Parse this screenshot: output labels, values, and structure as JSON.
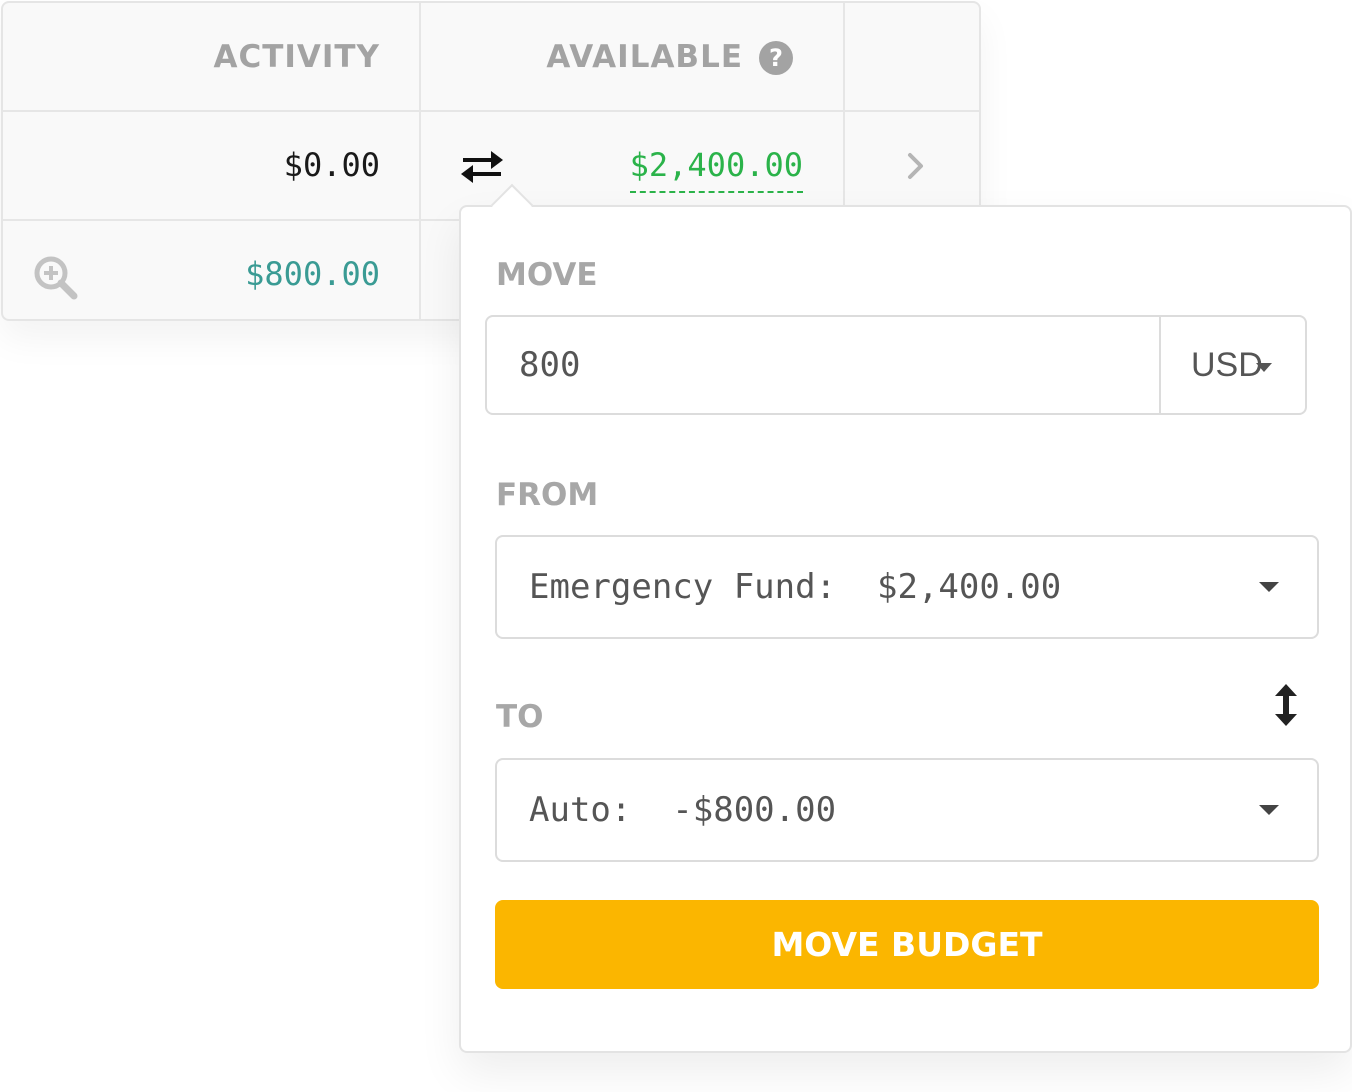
{
  "table": {
    "header": {
      "activity_label": "ACTIVITY",
      "available_label": "AVAILABLE",
      "help_icon": "question-circle-icon"
    },
    "row1": {
      "activity": "$0.00",
      "available": "$2,400.00",
      "move_icon": "swap-horizontal-icon",
      "expand_icon": "chevron-right-icon"
    },
    "row2": {
      "activity": "$800.00",
      "inspect_icon": "zoom-in-icon"
    }
  },
  "popover": {
    "move_label": "MOVE",
    "amount_value": "800",
    "currency": "USD",
    "from_label": "FROM",
    "from_value": "Emergency Fund:  $2,400.00",
    "to_label": "TO",
    "to_value": "Auto:  -$800.00",
    "swap_icon": "swap-vertical-icon",
    "submit_label": "MOVE BUDGET"
  },
  "colors": {
    "accent_button": "#fbb600",
    "positive_green": "#2bb34a",
    "teal_amount": "#3a9b94",
    "label_gray": "#a3a3a3"
  }
}
